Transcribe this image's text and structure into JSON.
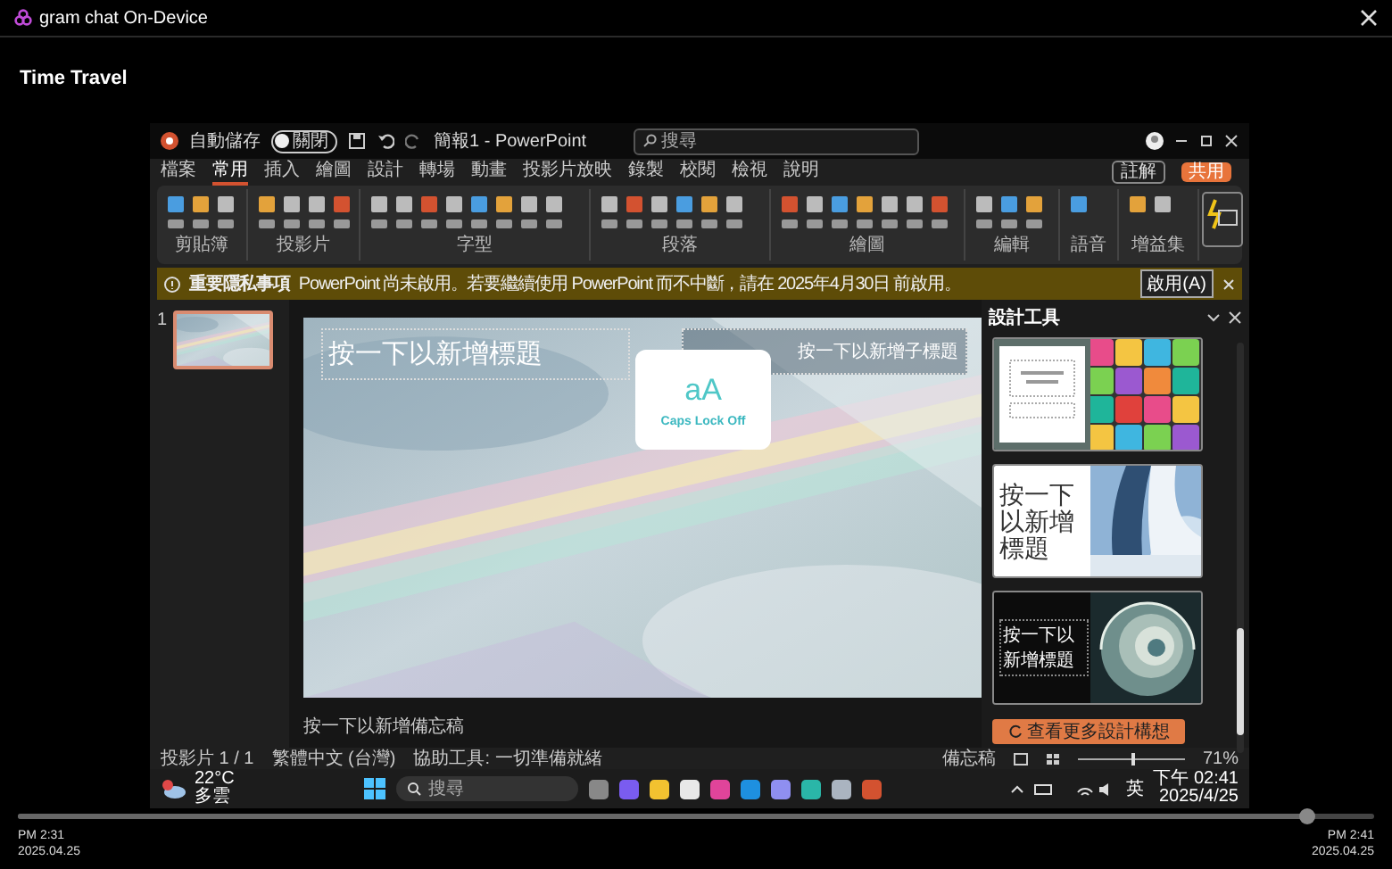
{
  "window": {
    "title": "gram chat On-Device"
  },
  "heading": "Time Travel",
  "capture": {
    "app_title": {
      "autosave_label": "自動儲存",
      "autosave_state": "關閉",
      "autosave_on": false,
      "document": "簡報1 - PowerPoint",
      "search_placeholder": "搜尋"
    },
    "ribbon_tabs": [
      {
        "label": "檔案",
        "selected": false
      },
      {
        "label": "常用",
        "selected": true
      },
      {
        "label": "插入",
        "selected": false
      },
      {
        "label": "繪圖",
        "selected": false
      },
      {
        "label": "設計",
        "selected": false
      },
      {
        "label": "轉場",
        "selected": false
      },
      {
        "label": "動畫",
        "selected": false
      },
      {
        "label": "投影片放映",
        "selected": false
      },
      {
        "label": "錄製",
        "selected": false
      },
      {
        "label": "校閱",
        "selected": false
      },
      {
        "label": "檢視",
        "selected": false
      },
      {
        "label": "說明",
        "selected": false
      }
    ],
    "ribbon_actions": [
      {
        "label": "註解",
        "kind": "outline"
      },
      {
        "label": "共用",
        "kind": "accent"
      }
    ],
    "ribbon_groups": [
      "剪貼簿",
      "投影片",
      "字型",
      "段落",
      "繪圖",
      "編輯",
      "語音",
      "增益集"
    ],
    "notice": {
      "title": "重要隱私事項",
      "text": "PowerPoint 尚未啟用。若要繼續使用 PowerPoint 而不中斷，請在 2025年4月30日 前啟用。",
      "button": "啟用(A)"
    },
    "slides": [
      {
        "number": "1",
        "selected": true
      }
    ],
    "slide": {
      "title_placeholder": "按一下以新增標題",
      "subtitle_placeholder": "按一下以新增子標題"
    },
    "notes_placeholder": "按一下以新增備忘稿",
    "overlay": {
      "glyph": "aA",
      "text": "Caps Lock Off"
    },
    "design_panel": {
      "title": "設計工具",
      "ideas": [
        {
          "kind": "blocks"
        },
        {
          "kind": "arch",
          "text": "按一下以新增標題"
        },
        {
          "kind": "shell",
          "text": "按一下以新增標題"
        }
      ],
      "button": "查看更多設計構想"
    },
    "status_bar": {
      "slide": "投影片 1 / 1",
      "language": "繁體中文 (台灣)",
      "accessibility": "協助工具: 一切準備就緒",
      "notes": "備忘稿",
      "zoom": "71%",
      "zoom_slider": {
        "level": 0.5
      }
    },
    "taskbar": {
      "temperature": "22°C",
      "weather": "多雲",
      "search_placeholder": "搜尋",
      "ime": "英",
      "time": "下午 02:41",
      "date": "2025/4/25"
    }
  },
  "timeline": {
    "level": 0.95,
    "start_time": "PM 2:31",
    "start_date": "2025.04.25",
    "end_time": "PM 2:41",
    "end_date": "2025.04.25"
  }
}
